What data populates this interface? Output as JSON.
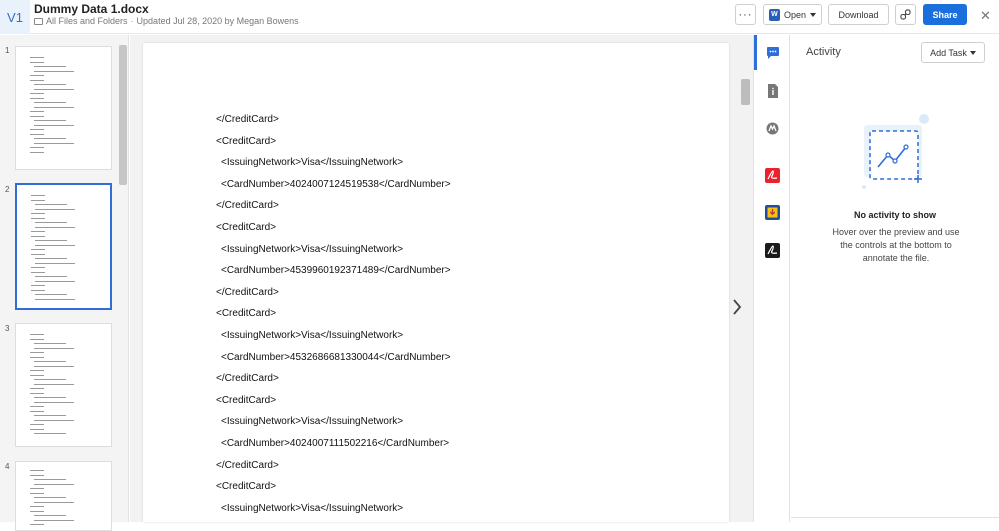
{
  "header": {
    "version_badge": "V1",
    "title": "Dummy Data 1.docx",
    "breadcrumb": "All Files and Folders",
    "updated": "Updated Jul 28, 2020 by Megan Bowens",
    "more_label": "···",
    "open_label": "Open",
    "download_label": "Download",
    "share_label": "Share",
    "close_label": "✕"
  },
  "thumbnails": {
    "page_numbers": [
      "1",
      "2",
      "3",
      "4"
    ],
    "active_page": 2
  },
  "document": {
    "lines": [
      {
        "indent": 0,
        "text": "</CreditCard>"
      },
      {
        "indent": 0,
        "text": "<CreditCard>"
      },
      {
        "indent": 1,
        "text": "<IssuingNetwork>Visa</IssuingNetwork>"
      },
      {
        "indent": 1,
        "text": "<CardNumber>4024007124519538</CardNumber>"
      },
      {
        "indent": 0,
        "text": "</CreditCard>"
      },
      {
        "indent": 0,
        "text": "<CreditCard>"
      },
      {
        "indent": 1,
        "text": "<IssuingNetwork>Visa</IssuingNetwork>"
      },
      {
        "indent": 1,
        "text": "<CardNumber>4539960192371489</CardNumber>"
      },
      {
        "indent": 0,
        "text": "</CreditCard>"
      },
      {
        "indent": 0,
        "text": "<CreditCard>"
      },
      {
        "indent": 1,
        "text": "<IssuingNetwork>Visa</IssuingNetwork>"
      },
      {
        "indent": 1,
        "text": "<CardNumber>4532686681330044</CardNumber>"
      },
      {
        "indent": 0,
        "text": "</CreditCard>"
      },
      {
        "indent": 0,
        "text": "<CreditCard>"
      },
      {
        "indent": 1,
        "text": "<IssuingNetwork>Visa</IssuingNetwork>"
      },
      {
        "indent": 1,
        "text": "<CardNumber>4024007111502216</CardNumber>"
      },
      {
        "indent": 0,
        "text": "</CreditCard>"
      },
      {
        "indent": 0,
        "text": "<CreditCard>"
      },
      {
        "indent": 1,
        "text": "<IssuingNetwork>Visa</IssuingNetwork>"
      }
    ]
  },
  "rail": {
    "icons": [
      "comment-icon",
      "info-icon",
      "box-sign-icon",
      "adobe-acrobat-icon",
      "download-app-icon",
      "adobe-sign-icon"
    ]
  },
  "activity": {
    "title": "Activity",
    "add_task_label": "Add Task",
    "empty_title": "No activity to show",
    "empty_desc": "Hover over the preview and use the controls at the bottom to annotate the file."
  },
  "colors": {
    "accent": "#1a6fdd",
    "active_outline": "#2e6ed6",
    "acrobat_red": "#e8232d"
  }
}
